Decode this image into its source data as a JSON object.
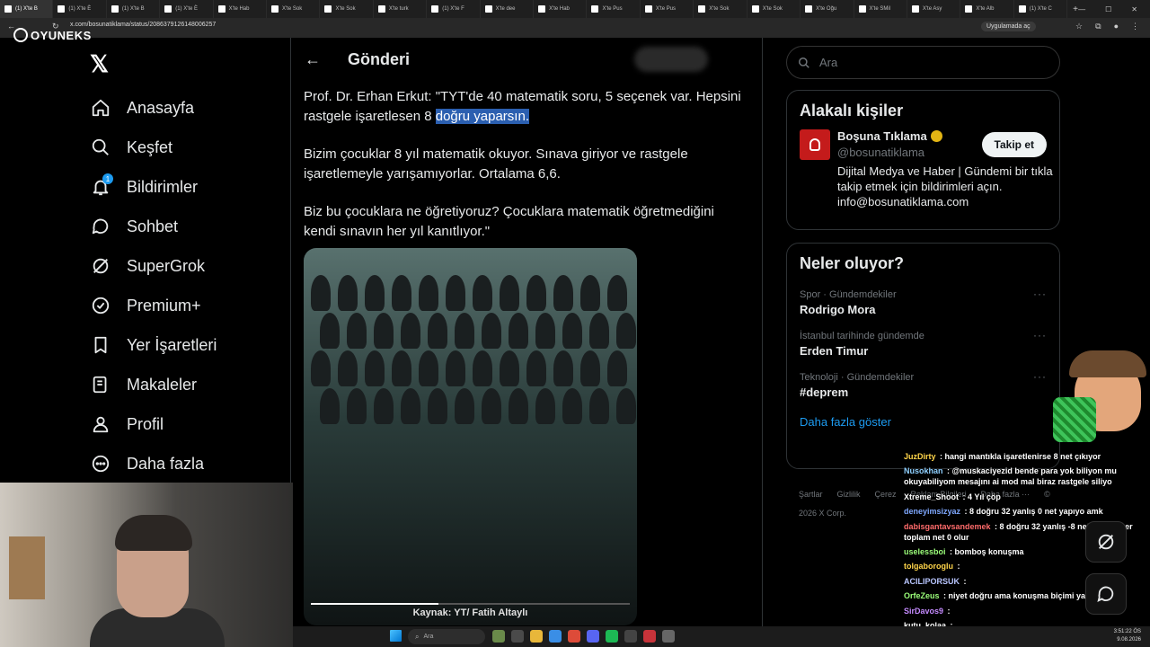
{
  "browser": {
    "tabs": [
      {
        "label": "(1) X'te B"
      },
      {
        "label": "(1) X'te È"
      },
      {
        "label": "(1) X'te B"
      },
      {
        "label": "(1) X'te È"
      },
      {
        "label": "X'te Hab"
      },
      {
        "label": "X'te Sok"
      },
      {
        "label": "X'te Sok"
      },
      {
        "label": "X'te turk"
      },
      {
        "label": "(1) X'te F"
      },
      {
        "label": "X'te dee"
      },
      {
        "label": "X'te Hab"
      },
      {
        "label": "X'te Pus"
      },
      {
        "label": "X'te Pus"
      },
      {
        "label": "X'te Sok"
      },
      {
        "label": "X'te Sok"
      },
      {
        "label": "X'te Oğu"
      },
      {
        "label": "X'te SMil"
      },
      {
        "label": "X'te Asy"
      },
      {
        "label": "X'te Alb"
      },
      {
        "label": "(1) X'te C"
      }
    ],
    "url": "x.com/bosunatiklama/status/2086379126148006257",
    "app_button": "Uygulamada aç"
  },
  "stream_brand": "OYUNEKS",
  "nav": {
    "items": [
      {
        "label": "Anasayfa",
        "icon": "home-icon"
      },
      {
        "label": "Keşfet",
        "icon": "search-icon"
      },
      {
        "label": "Bildirimler",
        "icon": "bell-icon",
        "badge": "1"
      },
      {
        "label": "Sohbet",
        "icon": "chat-icon"
      },
      {
        "label": "SuperGrok",
        "icon": "grok-icon"
      },
      {
        "label": "Premium+",
        "icon": "verified-icon"
      },
      {
        "label": "Yer İşaretleri",
        "icon": "bookmark-icon"
      },
      {
        "label": "Makaleler",
        "icon": "article-icon"
      },
      {
        "label": "Profil",
        "icon": "profile-icon"
      },
      {
        "label": "Daha fazla",
        "icon": "more-icon"
      }
    ]
  },
  "post": {
    "header": "Gönderi",
    "text_1a": "Prof. Dr. Erhan Erkut: \"TYT'de 40 matematik soru, 5 seçenek var. Hepsini rastgele işaretlesen 8 ",
    "text_1b": "doğru yaparsın.",
    "text_2": "Bizim çocuklar 8 yıl matematik okuyor. Sınava giriyor ve rastgele işaretlemeyle yarışamıyorlar. Ortalama 6,6.",
    "text_3": "Biz bu çocuklara ne öğretiyoruz? Çocuklara matematik öğretmediğini kendi sınavın her yıl kanıtlıyor.\"",
    "media_caption": "Kaynak: YT/ Fatih Altaylı"
  },
  "right": {
    "search_placeholder": "Ara",
    "relevant_title": "Alakalı kişiler",
    "person": {
      "name": "Boşuna Tıklama",
      "handle": "@bosunatiklama",
      "bio": "Dijital Medya ve Haber | Gündemi bir tıkla takip etmek için bildirimleri açın. info@bosunatiklama.com",
      "follow_label": "Takip et"
    },
    "trends_title": "Neler oluyor?",
    "trends": [
      {
        "meta": "Spor · Gündemdekiler",
        "name": "Rodrigo Mora"
      },
      {
        "meta": "İstanbul tarihinde gündemde",
        "name": "Erden Timur"
      },
      {
        "meta": "Teknoloji · Gündemdekiler",
        "name": "#deprem"
      }
    ],
    "show_more": "Daha fazla göster",
    "footer": [
      "Şartlar",
      "Gizlilik",
      "Çerez",
      "Reklam Bilgileri",
      "Daha fazla ···",
      "© 2026 X Corp."
    ]
  },
  "chat": [
    {
      "user": "JuzDirty",
      "color": "#ffd54a",
      "text": "hangi mantıkla işaretlenirse 8 net çıkıyor"
    },
    {
      "user": "Nusokhan",
      "color": "#8fd0ff",
      "text": "@muskaciyezid bende para yok biliyon mu okuyabiliyom mesajını ai mod mal biraz rastgele siliyo"
    },
    {
      "user": "Xtreme_Shoot",
      "color": "#ffffff",
      "text": "4 Yıl çöp"
    },
    {
      "user": "deneyimsizyaz",
      "color": "#7fa8ff",
      "text": "8 doğru 32 yanlış 0 net yapıyo amk"
    },
    {
      "user": "dabisgantavsandemek",
      "color": "#ff6b6b",
      "text": "8 doğru 32 yanlış -8 net ile beraber toplam net 0 olur"
    },
    {
      "user": "uselessboi",
      "color": "#9cff7a",
      "text": "bomboş konuşma"
    },
    {
      "user": "tolgaboroglu",
      "color": "#ffd54a",
      "text": ""
    },
    {
      "user": "ACILIPORSUK",
      "color": "#b9c6ff",
      "text": ""
    },
    {
      "user": "OrfeZeus",
      "color": "#9cff7a",
      "text": "niyet doğru ama konuşma biçimi yanlış"
    },
    {
      "user": "SirDavos9",
      "color": "#c58bff",
      "text": ""
    },
    {
      "user": "kutu_kolaa",
      "color": "#ffffff",
      "text": ""
    }
  ],
  "taskbar": {
    "search_placeholder": "Ara",
    "time": "3:51:22 ÖS",
    "date": "9.08.2026"
  }
}
